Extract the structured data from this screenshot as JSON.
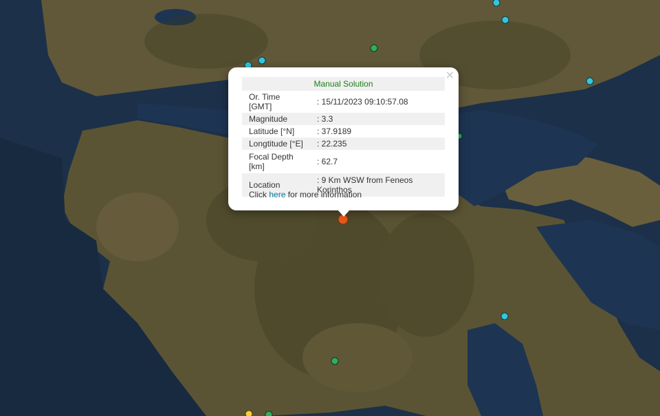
{
  "popup": {
    "title": "Manual Solution",
    "rows": [
      {
        "label": "Or. Time [GMT]",
        "value": ": 15/11/2023 09:10:57.08"
      },
      {
        "label": "Magnitude",
        "value": ": 3.3"
      },
      {
        "label": "Latitude [°N]",
        "value": ": 37.9189"
      },
      {
        "label": "Longtitude [°E]",
        "value": ": 22.235"
      },
      {
        "label": "Focal Depth [km]",
        "value": ": 62.7"
      },
      {
        "label": "Location",
        "value": ": 9 Km WSW from Feneos Korinthos"
      }
    ],
    "footer_prefix": "Click ",
    "footer_link": "here",
    "footer_suffix": " for more information",
    "close_symbol": "×"
  },
  "colors": {
    "selected_event": "#e8591a",
    "recent_event_cyan": "#35c6dc",
    "older_event_green": "#2fae5f",
    "event_yellow": "#f5d033",
    "sea": "#1b2f45",
    "land": "#5a5230"
  },
  "legend_none": ""
}
